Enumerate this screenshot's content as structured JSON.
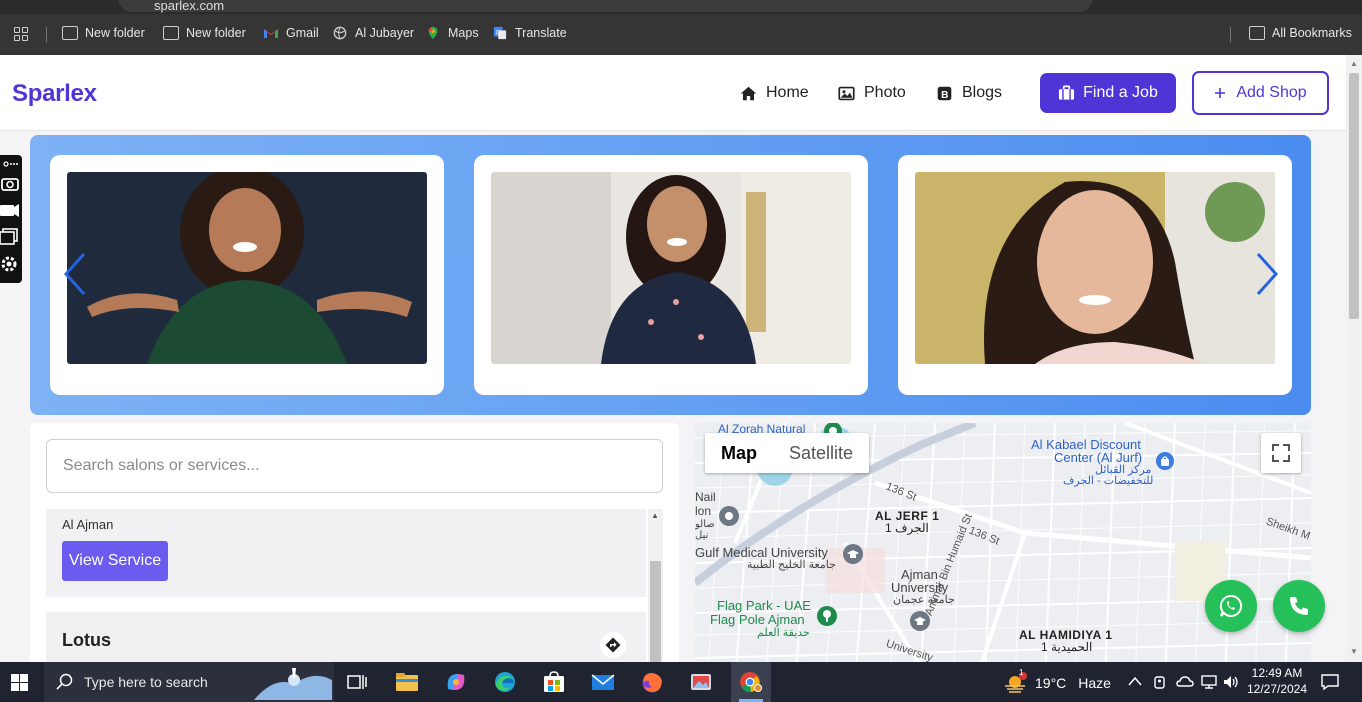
{
  "browser": {
    "url": "sparlex.com",
    "bookmarks": [
      "New folder",
      "New folder",
      "Gmail",
      "Al Jubayer",
      "Maps",
      "Translate"
    ],
    "all_bookmarks": "All Bookmarks"
  },
  "navbar": {
    "logo": "Sparlex",
    "links": [
      "Home",
      "Photo",
      "Blogs"
    ],
    "find_job": "Find a Job",
    "add_shop": "Add Shop"
  },
  "search": {
    "placeholder": "Search salons or services..."
  },
  "listing": {
    "item1_address": "Al Ajman",
    "view_service": "View Service",
    "item2_name": "Lotus"
  },
  "map": {
    "type_map": "Map",
    "type_satellite": "Satellite",
    "labels": {
      "al_zorah": "Al Zorah Natural",
      "kabael_en": "Al Kabael Discount",
      "kabael_en2": "Center (Al Jurf)",
      "kabael_ar": "مركز القبائل",
      "kabael_ar2": "للتخفيضات - الجرف",
      "nail_1": "Nail",
      "nail_2": "lon",
      "nail_3": "صالو",
      "nail_4": "نيل",
      "st_136_a": "136 St",
      "st_136_b": "136 St",
      "al_jerf_en": "AL JERF 1",
      "al_jerf_ar": "الجرف 1",
      "sheikh": "Sheikh M",
      "gulf_en": "Gulf Medical University",
      "gulf_ar": "جامعة الخليج الطبية",
      "ajman_en": "Ajman",
      "ajman_en2": "University",
      "ajman_ar": "جامعة عجمان",
      "humaid": "Ammar Bin Humaid St",
      "flag_en": "Flag Park - UAE",
      "flag_en2": "Flag Pole Ajman",
      "flag_ar": "حديقة العلم",
      "hamidiya_en": "AL HAMIDIYA 1",
      "hamidiya_ar": "الحميدية 1",
      "university": "University"
    }
  },
  "taskbar": {
    "search_placeholder": "Type here to search",
    "weather_temp": "19°C",
    "weather_desc": "Haze",
    "weather_badge": "1",
    "time": "12:49 AM",
    "date": "12/27/2024"
  },
  "colors": {
    "brand": "#4f35d6",
    "view_service": "#6b5cf0",
    "whatsapp": "#25c05a",
    "hero_gradient_start": "#7eb2f5",
    "hero_gradient_end": "#4b8cf0"
  },
  "icons": [
    "home-icon",
    "image-icon",
    "blog-icon",
    "briefcase-icon",
    "plus-icon",
    "chevron-left-icon",
    "chevron-right-icon",
    "whatsapp-icon",
    "phone-icon",
    "directions-icon",
    "fullscreen-icon"
  ]
}
